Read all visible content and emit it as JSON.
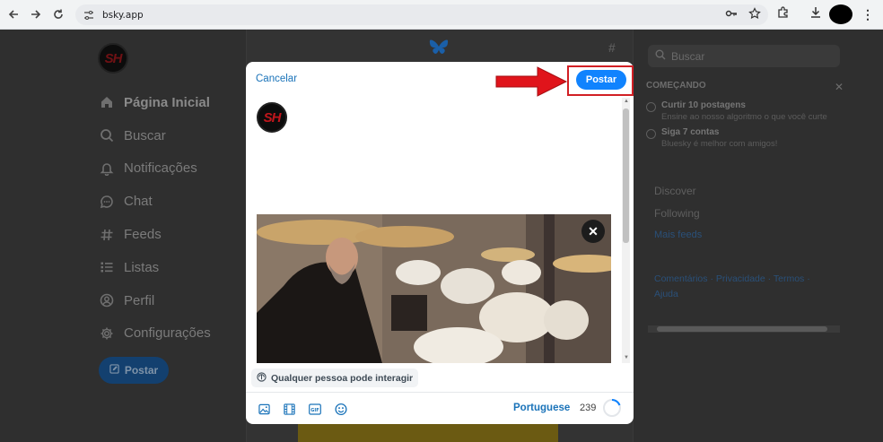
{
  "browser": {
    "url": "bsky.app",
    "icons": [
      "back-icon",
      "forward-icon",
      "reload-icon",
      "site-info-icon",
      "key-icon",
      "star-icon",
      "extensions-icon",
      "download-icon",
      "profile-avatar",
      "menu-icon"
    ]
  },
  "sidebar": {
    "items": [
      {
        "label": "Página Inicial",
        "icon": "home-icon"
      },
      {
        "label": "Buscar",
        "icon": "search-icon"
      },
      {
        "label": "Notificações",
        "icon": "bell-icon"
      },
      {
        "label": "Chat",
        "icon": "chat-icon"
      },
      {
        "label": "Feeds",
        "icon": "hash-icon"
      },
      {
        "label": "Listas",
        "icon": "list-icon"
      },
      {
        "label": "Perfil",
        "icon": "profile-icon"
      },
      {
        "label": "Configurações",
        "icon": "gear-icon"
      }
    ],
    "post_button": "Postar",
    "logo_text": "SH"
  },
  "right": {
    "search_placeholder": "Buscar",
    "getting_started": {
      "title": "COMEÇANDO",
      "tasks": [
        {
          "title": "Curtir 10 postagens",
          "desc": "Ensine ao nosso algoritmo o que você curte"
        },
        {
          "title": "Siga 7 contas",
          "desc": "Bluesky é melhor com amigos!"
        }
      ]
    },
    "feeds": [
      "Discover",
      "Following"
    ],
    "more_feeds": "Mais feeds",
    "footer": "Comentários · Privacidade · Termos · Ajuda"
  },
  "composer": {
    "cancel": "Cancelar",
    "post": "Postar",
    "interaction": "Qualquer pessoa pode interagir",
    "language": "Portuguese",
    "char_count": "239",
    "accent": "#1083fe",
    "annotation_color": "#d11f24",
    "tools": [
      "image-icon",
      "video-icon",
      "gif-icon",
      "emoji-icon"
    ]
  }
}
